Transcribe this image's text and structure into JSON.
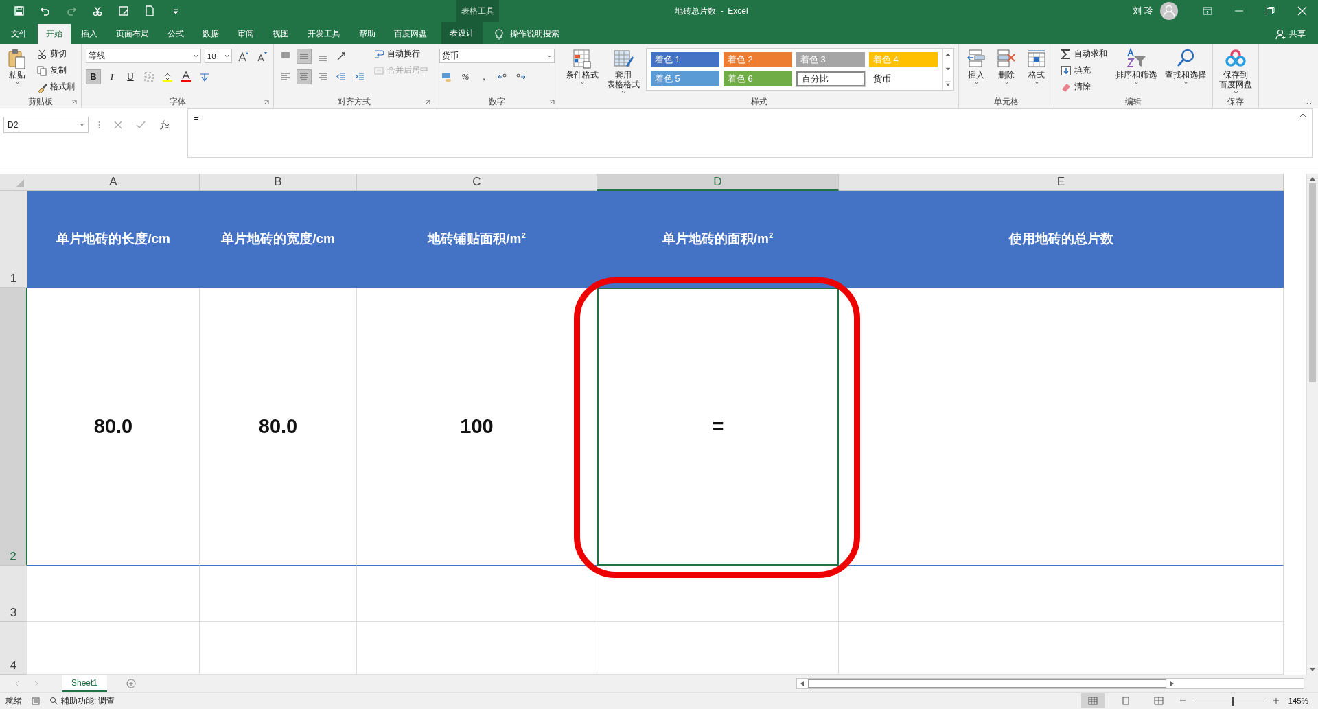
{
  "title_bar": {
    "contextual_label": "表格工具",
    "title": "地砖总片数  -  Excel",
    "user": "刘 玲"
  },
  "tabs": [
    {
      "label": "文件",
      "selected": false,
      "kind": "normal"
    },
    {
      "label": "开始",
      "selected": true,
      "kind": "normal"
    },
    {
      "label": "插入",
      "selected": false,
      "kind": "normal"
    },
    {
      "label": "页面布局",
      "selected": false,
      "kind": "normal"
    },
    {
      "label": "公式",
      "selected": false,
      "kind": "normal"
    },
    {
      "label": "数据",
      "selected": false,
      "kind": "normal"
    },
    {
      "label": "审阅",
      "selected": false,
      "kind": "normal"
    },
    {
      "label": "视图",
      "selected": false,
      "kind": "normal"
    },
    {
      "label": "开发工具",
      "selected": false,
      "kind": "normal"
    },
    {
      "label": "帮助",
      "selected": false,
      "kind": "normal"
    },
    {
      "label": "百度网盘",
      "selected": false,
      "kind": "normal"
    },
    {
      "label": "表设计",
      "selected": false,
      "kind": "contextual"
    }
  ],
  "tell_me": "操作说明搜索",
  "share": "共享",
  "ribbon": [
    {
      "label": "剪贴板",
      "columns": [
        [
          {
            "kind": "large",
            "label": "粘贴"
          }
        ],
        [
          {
            "kind": "small",
            "label": "剪切"
          },
          {
            "kind": "small",
            "label": "复制"
          },
          {
            "kind": "small",
            "label": "格式刷"
          }
        ]
      ]
    },
    {
      "label": "字体",
      "columns": [
        [
          {
            "kind": "row",
            "items": [
              {
                "kind": "combo",
                "value": "等线"
              },
              {
                "kind": "small-combo",
                "value": "18"
              },
              {
                "kind": "icon",
                "selected": false
              },
              {
                "kind": "icon",
                "selected": false
              }
            ]
          },
          {
            "kind": "row",
            "items": [
              {
                "kind": "toggle",
                "label": "B",
                "selected": true
              },
              {
                "kind": "toggle",
                "label": "I",
                "selected": false
              },
              {
                "kind": "toggle",
                "label": "U",
                "selected": false
              },
              {
                "kind": "icon",
                "selected": false
              },
              {
                "kind": "icon",
                "selected": false
              },
              {
                "kind": "icon",
                "selected": false
              },
              {
                "kind": "icon",
                "selected": false
              }
            ]
          }
        ]
      ]
    },
    {
      "label": "对齐方式",
      "columns": [
        [
          {
            "kind": "row",
            "items": [
              {
                "kind": "icon",
                "selected": false
              },
              {
                "kind": "icon",
                "selected": true
              },
              {
                "kind": "icon",
                "selected": false
              },
              {
                "kind": "icon",
                "selected": false
              }
            ]
          },
          {
            "kind": "row",
            "items": [
              {
                "kind": "icon",
                "selected": false
              },
              {
                "kind": "icon",
                "selected": true
              },
              {
                "kind": "icon",
                "selected": false
              },
              {
                "kind": "icon",
                "selected": false
              },
              {
                "kind": "icon",
                "selected": false
              }
            ]
          }
        ],
        [
          {
            "kind": "small",
            "label": "自动换行",
            "disabled": false
          },
          {
            "kind": "small",
            "label": "合并后居中",
            "disabled": true
          }
        ]
      ]
    },
    {
      "label": "数字",
      "columns": [
        [
          {
            "kind": "row",
            "items": [
              {
                "kind": "combo",
                "value": "货币"
              }
            ]
          },
          {
            "kind": "row",
            "items": [
              {
                "kind": "icon",
                "selected": false
              },
              {
                "kind": "toggle",
                "label": "%",
                "selected": false
              },
              {
                "kind": "toggle",
                "label": ",",
                "selected": false
              },
              {
                "kind": "icon",
                "selected": false
              },
              {
                "kind": "icon",
                "selected": false
              }
            ]
          }
        ]
      ]
    },
    {
      "label": "样式",
      "columns": [
        [
          {
            "kind": "large",
            "label": "条件格式"
          }
        ],
        [
          {
            "kind": "large",
            "lines": [
              "套用",
              "表格格式"
            ]
          }
        ],
        [
          {
            "kind": "gallery",
            "styles": [
              {
                "label": "着色 1",
                "color": "#4472c4",
                "selected": false
              },
              {
                "label": "着色 2",
                "color": "#ed7d31",
                "selected": false
              },
              {
                "label": "着色 3",
                "color": "#a5a5a5",
                "selected": false
              },
              {
                "label": "着色 4",
                "color": "#ffc000",
                "selected": false
              },
              {
                "label": "着色 5",
                "color": "#5b9bd5",
                "selected": false
              },
              {
                "label": "着色 6",
                "color": "#70ad47",
                "selected": false
              },
              {
                "label": "百分比",
                "color": "#ffffff",
                "selected": true
              },
              {
                "label": "货币",
                "color": "#ffffff",
                "selected": false
              }
            ]
          }
        ]
      ]
    },
    {
      "label": "单元格",
      "columns": [
        [
          {
            "kind": "large",
            "label": "插入"
          }
        ],
        [
          {
            "kind": "large",
            "label": "删除"
          }
        ],
        [
          {
            "kind": "large",
            "label": "格式"
          }
        ]
      ]
    },
    {
      "label": "编辑",
      "columns": [
        [
          {
            "kind": "small",
            "label": "自动求和"
          },
          {
            "kind": "small",
            "label": "填充"
          },
          {
            "kind": "small",
            "label": "清除"
          }
        ],
        [
          {
            "kind": "large",
            "label": "排序和筛选"
          }
        ],
        [
          {
            "kind": "large",
            "label": "查找和选择"
          }
        ]
      ]
    },
    {
      "label": "保存",
      "columns": [
        [
          {
            "kind": "large",
            "lines": [
              "保存到",
              "百度网盘"
            ]
          }
        ]
      ]
    }
  ],
  "name_box": "D2",
  "formula": "=",
  "columns": [
    {
      "label": "A",
      "selected": false
    },
    {
      "label": "B",
      "selected": false
    },
    {
      "label": "C",
      "selected": false
    },
    {
      "label": "D",
      "selected": true
    },
    {
      "label": "E",
      "selected": false
    }
  ],
  "rows": [
    {
      "label": "1",
      "selected": false,
      "kind": "header",
      "cells": [
        {
          "text": "单片地砖的长度/cm",
          "selected": false
        },
        {
          "text": "单片地砖的宽度/cm",
          "selected": false
        },
        {
          "text": "地砖铺贴面积/m$^{2}$",
          "selected": false
        },
        {
          "text": "单片地砖的面积/m$^{2}$",
          "selected": false
        },
        {
          "text": "使用地砖的总片数",
          "selected": false
        }
      ]
    },
    {
      "label": "2",
      "selected": true,
      "kind": "value",
      "cells": [
        {
          "text": "80.0",
          "selected": false
        },
        {
          "text": "80.0",
          "selected": false
        },
        {
          "text": "100",
          "selected": false
        },
        {
          "text": "=",
          "selected": true
        }
      ]
    },
    {
      "label": "3",
      "selected": false,
      "kind": "empty",
      "cells": []
    },
    {
      "label": "4",
      "selected": false,
      "kind": "empty",
      "cells": []
    }
  ],
  "sheet_tabs": [
    {
      "label": "Sheet1",
      "selected": true
    }
  ],
  "status_bar": {
    "ready": "就绪",
    "accessibility": "辅助功能: 调查",
    "zoom": {
      "level": 0.55,
      "reading": "145%"
    }
  }
}
